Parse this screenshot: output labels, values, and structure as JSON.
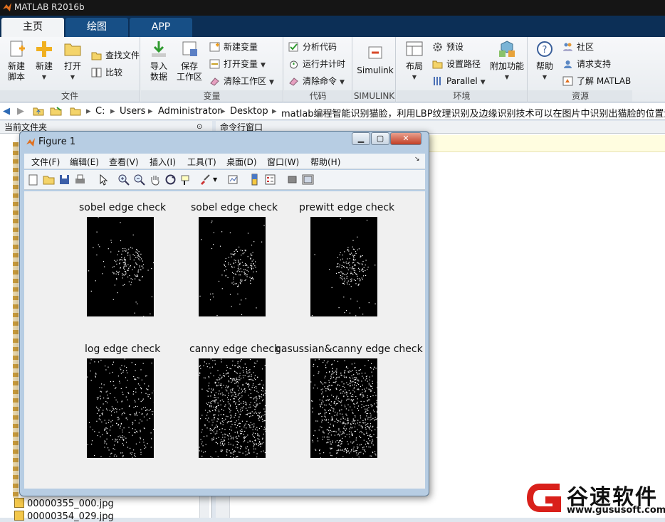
{
  "window": {
    "title": "MATLAB R2016b"
  },
  "tabs": [
    {
      "label": "主页"
    },
    {
      "label": "绘图"
    },
    {
      "label": "APP"
    }
  ],
  "ribbon": {
    "file": {
      "group_label": "文件",
      "new_script": "新建\n脚本",
      "new": "新建",
      "open": "打开",
      "find_files": "查找文件",
      "compare": "比较"
    },
    "variable": {
      "group_label": "变量",
      "import_data": "导入\n数据",
      "save_workspace": "保存\n工作区",
      "new_variable": "新建变量",
      "open_variable": "打开变量",
      "clear_workspace": "清除工作区"
    },
    "code": {
      "group_label": "代码",
      "analyze_code": "分析代码",
      "run_and_time": "运行并计时",
      "clear_commands": "清除命令"
    },
    "simulink": {
      "group_label": "SIMULINK",
      "simulink": "Simulink"
    },
    "environment": {
      "group_label": "环境",
      "layout": "布局",
      "preferences": "预设",
      "set_path": "设置路径",
      "parallel": "Parallel",
      "add_ons": "附加功能"
    },
    "resources": {
      "group_label": "资源",
      "help": "帮助",
      "community": "社区",
      "request_support": "请求支持",
      "learn_matlab": "了解 MATLAB"
    }
  },
  "address": {
    "crumbs": [
      "C:",
      "Users",
      "Administrator",
      "Desktop",
      "matlab编程智能识别猫脸，利用LBP纹理识别及边缘识别技术可以在图片中识别出猫脸的位置源码程序"
    ]
  },
  "left_panel": {
    "title": "当前文件夹",
    "files": [
      "00000355_000.jpg",
      "00000354_029.jpg"
    ]
  },
  "right_panel": {
    "title": "命令行窗口"
  },
  "figure": {
    "title": "Figure 1",
    "menu": [
      "文件(F)",
      "编辑(E)",
      "查看(V)",
      "插入(I)",
      "工具(T)",
      "桌面(D)",
      "窗口(W)",
      "帮助(H)"
    ],
    "plots": [
      {
        "title": "sobel edge check"
      },
      {
        "title": "sobel edge check"
      },
      {
        "title": "prewitt edge check"
      },
      {
        "title": "log edge check"
      },
      {
        "title": "canny edge check"
      },
      {
        "title": "gasussian&canny edge check"
      }
    ]
  },
  "watermark": {
    "brand": "谷速软件",
    "url": "www.gususoft.com"
  },
  "colors": {
    "title_bar": "#151515",
    "tab_bar": "#0c2f56",
    "ribbon": "#eef1f4",
    "figure_frame": "#b7cde3",
    "watermark_red": "#d9201a"
  }
}
